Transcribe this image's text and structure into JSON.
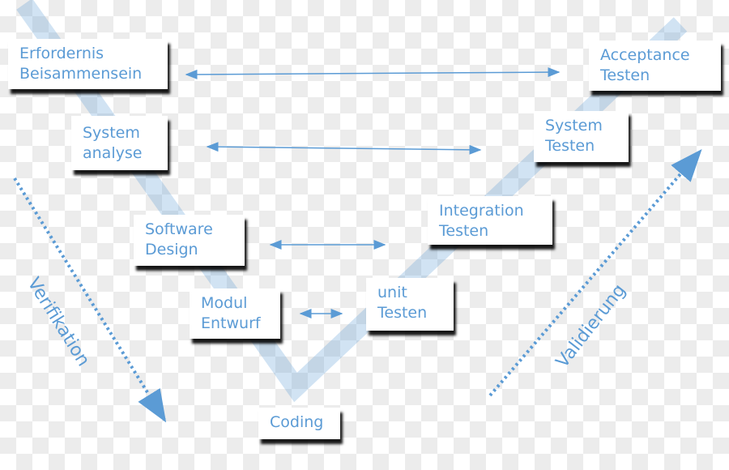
{
  "colors": {
    "accent": "#5b9bd5",
    "band": "#bcd6ee",
    "shadow": "#000000"
  },
  "left_boxes": [
    {
      "lines": [
        "Erfordernis",
        "Beisammensein"
      ]
    },
    {
      "lines": [
        "System",
        "analyse"
      ]
    },
    {
      "lines": [
        "Software",
        "Design"
      ]
    },
    {
      "lines": [
        "Modul",
        "Entwurf"
      ]
    }
  ],
  "right_boxes": [
    {
      "lines": [
        "Acceptance",
        "Testen"
      ]
    },
    {
      "lines": [
        "System",
        "Testen"
      ]
    },
    {
      "lines": [
        "Integration",
        "Testen"
      ]
    },
    {
      "lines": [
        "unit",
        "Testen"
      ]
    }
  ],
  "bottom_box": {
    "label": "Coding"
  },
  "side_labels": {
    "left": "Verifikation",
    "right": "Validierung"
  }
}
